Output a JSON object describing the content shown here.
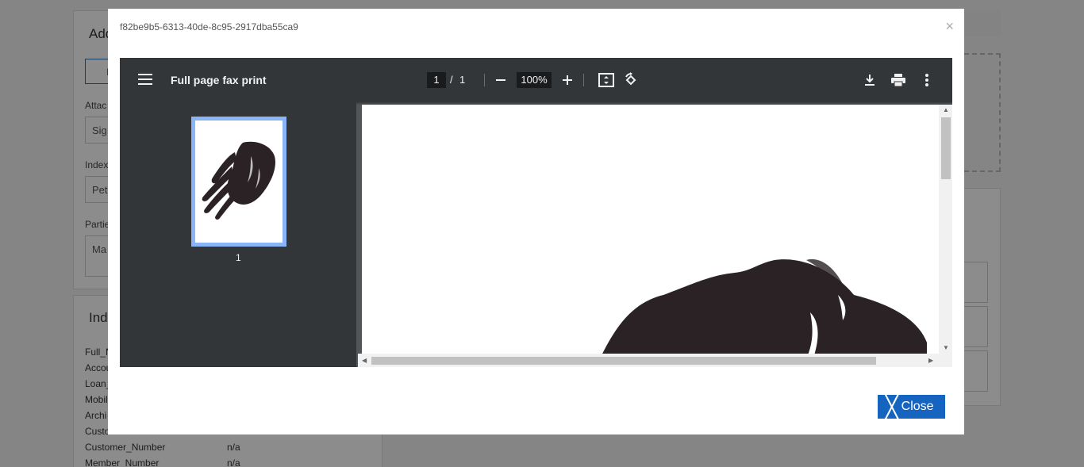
{
  "background": {
    "title_top": "Add",
    "title_bottom": "Ind",
    "btn_partial": "I",
    "attach_label": "Attac",
    "attach_value": "Sig",
    "index_label": "Index",
    "index_value": "Pet",
    "parties_label": "Partie",
    "parties_value": "Ma",
    "fields": [
      {
        "label": "Full_N",
        "value": ""
      },
      {
        "label": "Accou",
        "value": ""
      },
      {
        "label": "Loan_",
        "value": ""
      },
      {
        "label": "Mobil",
        "value": ""
      },
      {
        "label": "Archi",
        "value": ""
      },
      {
        "label": "Custo",
        "value": ""
      },
      {
        "label": "Customer_Number",
        "value": "n/a"
      },
      {
        "label": "Member_Number",
        "value": "n/a"
      }
    ]
  },
  "modal": {
    "title": "f82be9b5-6313-40de-8c95-2917dba55ca9",
    "close_x": "×",
    "close_button": "Close",
    "close_glyph": "╳"
  },
  "viewer": {
    "document_title": "Full page fax print",
    "current_page": "1",
    "separator": "/",
    "total_pages": "1",
    "zoom": "100%",
    "thumbnail_label": "1"
  },
  "colors": {
    "toolbar": "#323639",
    "sidebar": "#323639",
    "thumb_border": "#8ab4f8",
    "close_button": "#1565c0"
  }
}
